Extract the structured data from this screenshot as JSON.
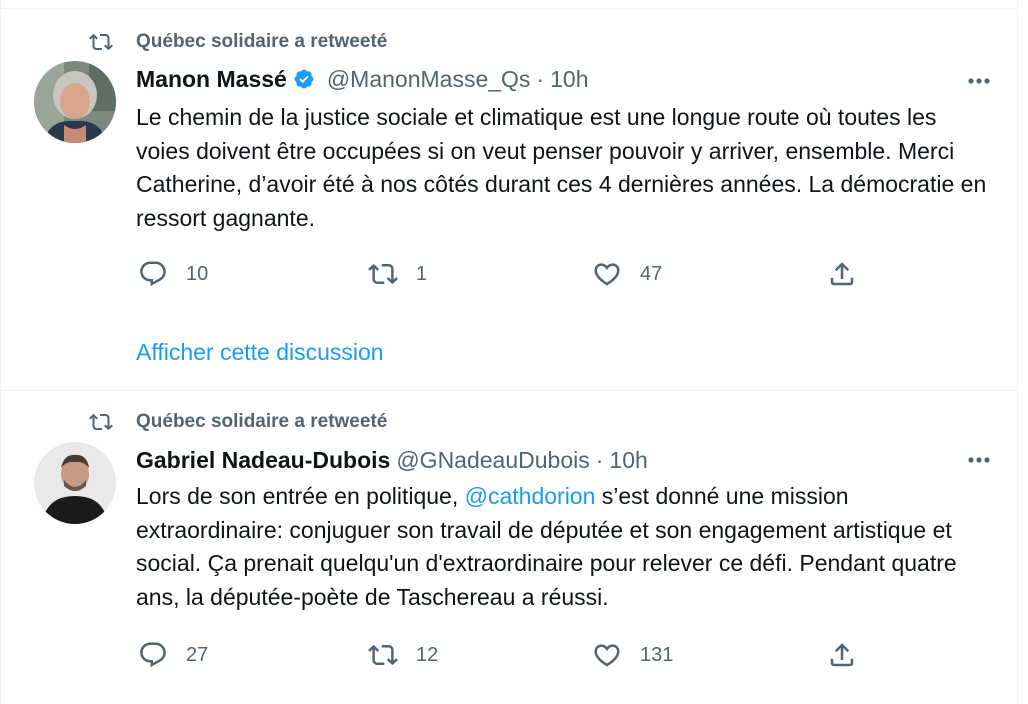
{
  "tweets": [
    {
      "retweet_label": "Québec solidaire a retweeté",
      "author_name": "Manon Massé",
      "verified": true,
      "handle": "@ManonMasse_Qs",
      "separator": "·",
      "time": "10h",
      "text_parts": [
        "Le chemin de la justice sociale et climatique est une longue route où toutes les voies doivent être occupées si on veut penser pouvoir y arriver, ensemble. Merci Catherine, d’avoir été à nos côtés durant ces 4 dernières années. La démocratie en ressort gagnante."
      ],
      "replies": "10",
      "retweets": "1",
      "likes": "47",
      "show_thread": "Afficher cette discussion"
    },
    {
      "retweet_label": "Québec solidaire a retweeté",
      "author_name": "Gabriel Nadeau-Dubois",
      "verified": false,
      "handle": "@GNadeauDubois",
      "separator": "·",
      "time": "10h",
      "text_before": "Lors de son entrée en politique, ",
      "mention": "@cathdorion",
      "text_after": " s’est donné une mission extraordinaire: conjuguer son travail de députée et son engagement artistique et social. Ça prenait quelqu'un d'extraordinaire pour relever ce défi. Pendant quatre ans, la députée-poète de Taschereau a réussi.",
      "replies": "27",
      "retweets": "12",
      "likes": "131"
    }
  ],
  "icons": {
    "retweet": "retweet-icon",
    "more": "more-icon",
    "reply": "reply-icon",
    "like": "like-icon",
    "share": "share-icon",
    "verified": "verified-badge-icon"
  },
  "colors": {
    "accent": "#1d9bf0",
    "secondary_text": "#536471",
    "primary_text": "#0f1419",
    "divider": "#eff3f4"
  }
}
